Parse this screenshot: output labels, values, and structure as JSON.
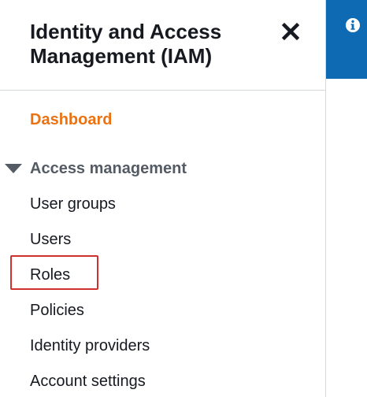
{
  "sidebar": {
    "title": "Identity and Access Management (IAM)",
    "close_icon": "close-icon",
    "dashboard_label": "Dashboard",
    "section": {
      "label": "Access management",
      "expanded": true,
      "items": [
        {
          "label": "User groups"
        },
        {
          "label": "Users"
        },
        {
          "label": "Roles",
          "highlighted": true
        },
        {
          "label": "Policies"
        },
        {
          "label": "Identity providers"
        },
        {
          "label": "Account settings"
        }
      ]
    }
  },
  "info_panel": {
    "icon": "info-icon",
    "color": "#0f6ab4"
  },
  "colors": {
    "dashboard_accent": "#ec7211",
    "highlight_border": "#d0312d"
  }
}
